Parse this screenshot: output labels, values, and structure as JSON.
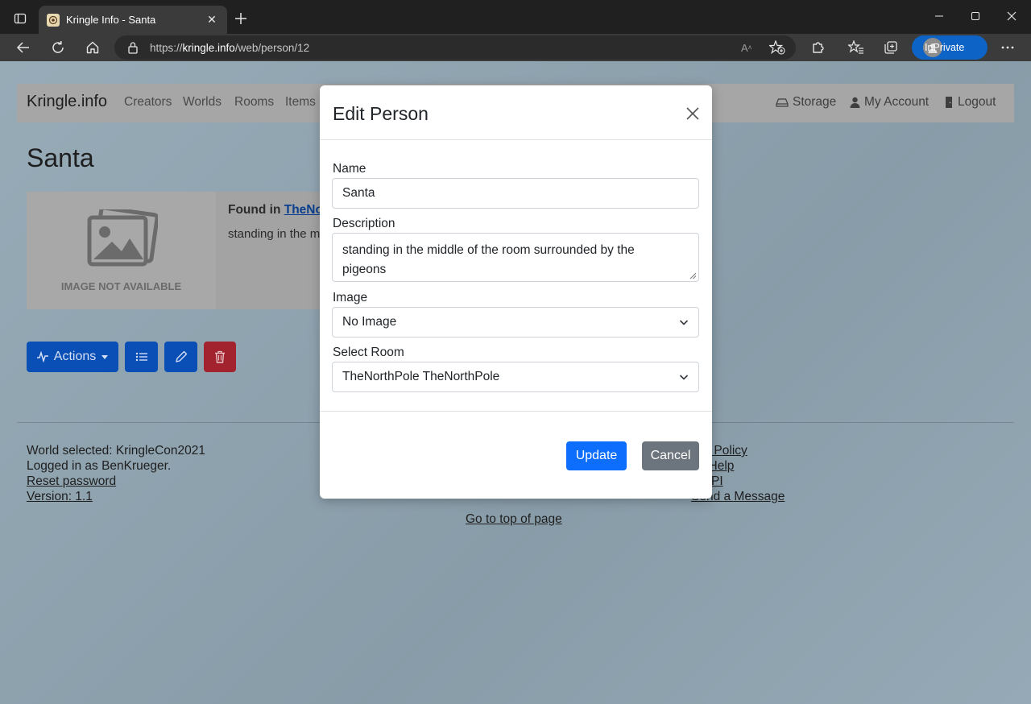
{
  "browser": {
    "tab_title": "Kringle Info - Santa",
    "url_prefix": "https://",
    "url_domain": "kringle.info",
    "url_path": "/web/person/12",
    "inprivate_label": "InPrivate"
  },
  "nav": {
    "brand": "Kringle.info",
    "links": [
      "Creators",
      "Worlds",
      "Rooms",
      "Items"
    ],
    "storage": "Storage",
    "account": "My Account",
    "logout": "Logout"
  },
  "page": {
    "title": "Santa",
    "image_placeholder": "IMAGE NOT AVAILABLE",
    "found_in_label": "Found in",
    "found_in_link": "TheNo",
    "description_preview": "standing in the m",
    "actions_label": "Actions"
  },
  "footer": {
    "world_selected": "World selected: KringleCon2021",
    "logged_in": "Logged in as BenKrueger.",
    "reset_password": "Reset password",
    "version": "Version: 1.1",
    "privacy": "acy Policy",
    "help": "en Help",
    "api": "w API",
    "message": "Send a Message",
    "to_top": "Go to top of page"
  },
  "modal": {
    "title": "Edit Person",
    "name_label": "Name",
    "name_value": "Santa",
    "description_label": "Description",
    "description_value": "standing in the middle of the room surrounded by the pigeons",
    "image_label": "Image",
    "image_value": "No Image",
    "room_label": "Select Room",
    "room_value": "TheNorthPole TheNorthPole",
    "update_label": "Update",
    "cancel_label": "Cancel"
  },
  "colors": {
    "primary": "#0d6efd",
    "secondary": "#6c757d",
    "inprivate": "#0d63c6"
  }
}
